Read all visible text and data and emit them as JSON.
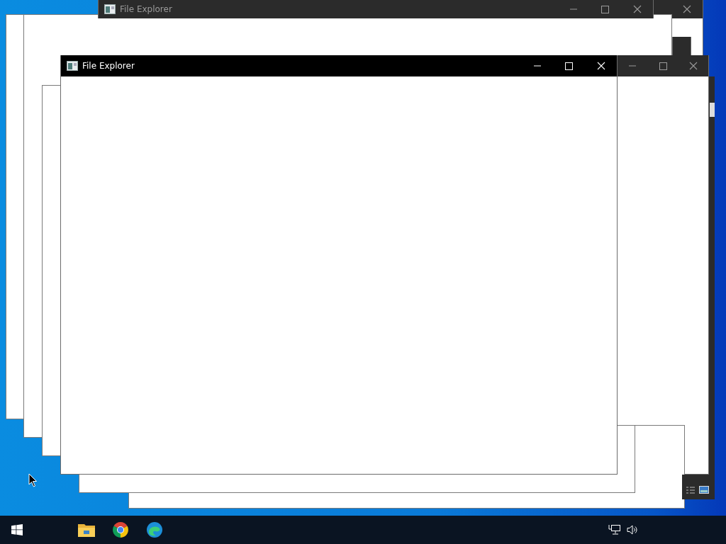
{
  "windows": [
    {
      "title": "File Explorer",
      "active": false
    },
    {
      "title": "File Explorer",
      "active": true
    }
  ]
}
